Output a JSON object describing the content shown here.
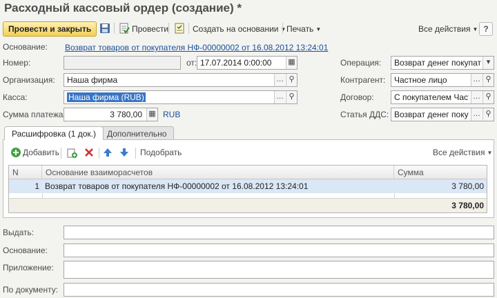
{
  "window": {
    "title": "Расходный кассовый ордер (создание) *"
  },
  "toolbar": {
    "post_close": "Провести и закрыть",
    "post": "Провести",
    "create_based": "Создать на основании",
    "print": "Печать",
    "all_actions": "Все действия",
    "help": "?"
  },
  "form": {
    "basis_label": "Основание:",
    "basis_link": "Возврат товаров от покупателя НФ-00000002 от 16.08.2012 13:24:01",
    "number_label": "Номер:",
    "number_value": "",
    "date_label": "от:",
    "date_value": "17.07.2014  0:00:00",
    "organization_label": "Организация:",
    "organization_value": "Наша фирма",
    "cashbox_label": "Касса:",
    "cashbox_value": "Наша фирма (RUB)",
    "amount_label": "Сумма платежа:",
    "amount_value": "3 780,00",
    "currency": "RUB",
    "operation_label": "Операция:",
    "operation_value": "Возврат денег покупател",
    "counterparty_label": "Контрагент:",
    "counterparty_value": "Частное лицо",
    "contract_label": "Договор:",
    "contract_value": "С покупателем Частно",
    "cashflow_label": "Статья ДДС:",
    "cashflow_value": "Возврат денег покупат"
  },
  "tabs": [
    {
      "label": "Расшифровка (1 док.)",
      "active": true
    },
    {
      "label": "Дополнительно",
      "active": false
    }
  ],
  "table_toolbar": {
    "add": "Добавить",
    "select": "Подобрать",
    "all_actions": "Все действия"
  },
  "table": {
    "columns": [
      "N",
      "Основание взаиморасчетов",
      "Сумма"
    ],
    "rows": [
      {
        "n": "1",
        "basis": "Возврат товаров от покупателя НФ-00000002 от 16.08.2012 13:24:01",
        "sum": "3 780,00"
      }
    ],
    "total": "3 780,00"
  },
  "bottom": {
    "issue_label": "Выдать:",
    "issue_value": "",
    "basis_label": "Основание:",
    "basis_value": "",
    "attachment_label": "Приложение:",
    "attachment_value": "",
    "document_label": "По документу:",
    "document_value": ""
  },
  "colors": {
    "accent_button": "#f3cf56",
    "link": "#1a4f9c",
    "selection": "#3a75c4",
    "row_highlight": "#d9e7f6"
  }
}
